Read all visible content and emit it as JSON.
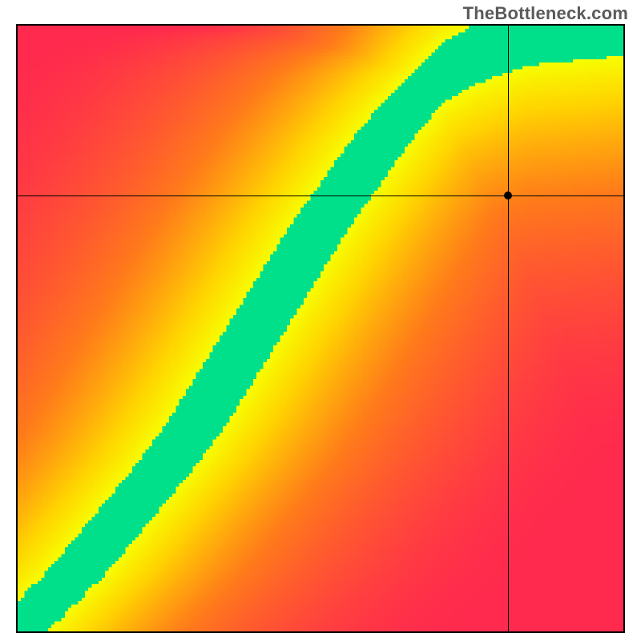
{
  "watermark": "TheBottleneck.com",
  "chart_data": {
    "type": "heatmap",
    "title": "",
    "xlabel": "",
    "ylabel": "",
    "xlim": [
      0,
      1
    ],
    "ylim": [
      0,
      1
    ],
    "marker": {
      "x": 0.81,
      "y": 0.72
    },
    "crosshair": {
      "x": 0.81,
      "y": 0.72
    },
    "optimal_curve": [
      {
        "x": 0.0,
        "y": 0.0
      },
      {
        "x": 0.05,
        "y": 0.05
      },
      {
        "x": 0.1,
        "y": 0.1
      },
      {
        "x": 0.15,
        "y": 0.16
      },
      {
        "x": 0.2,
        "y": 0.22
      },
      {
        "x": 0.25,
        "y": 0.28
      },
      {
        "x": 0.3,
        "y": 0.35
      },
      {
        "x": 0.35,
        "y": 0.43
      },
      {
        "x": 0.4,
        "y": 0.51
      },
      {
        "x": 0.45,
        "y": 0.59
      },
      {
        "x": 0.5,
        "y": 0.67
      },
      {
        "x": 0.55,
        "y": 0.74
      },
      {
        "x": 0.6,
        "y": 0.81
      },
      {
        "x": 0.65,
        "y": 0.87
      },
      {
        "x": 0.7,
        "y": 0.92
      },
      {
        "x": 0.75,
        "y": 0.95
      },
      {
        "x": 0.8,
        "y": 0.97
      },
      {
        "x": 0.85,
        "y": 0.985
      },
      {
        "x": 0.9,
        "y": 0.99
      },
      {
        "x": 0.95,
        "y": 0.995
      },
      {
        "x": 1.0,
        "y": 1.0
      }
    ],
    "band_width": 0.05,
    "color_stops": [
      {
        "t": 0.0,
        "color": "#ff2a4d"
      },
      {
        "t": 0.4,
        "color": "#ff7a1a"
      },
      {
        "t": 0.7,
        "color": "#ffd400"
      },
      {
        "t": 0.88,
        "color": "#f7ff00"
      },
      {
        "t": 1.0,
        "color": "#00e08a"
      }
    ],
    "grid_resolution": 180
  }
}
